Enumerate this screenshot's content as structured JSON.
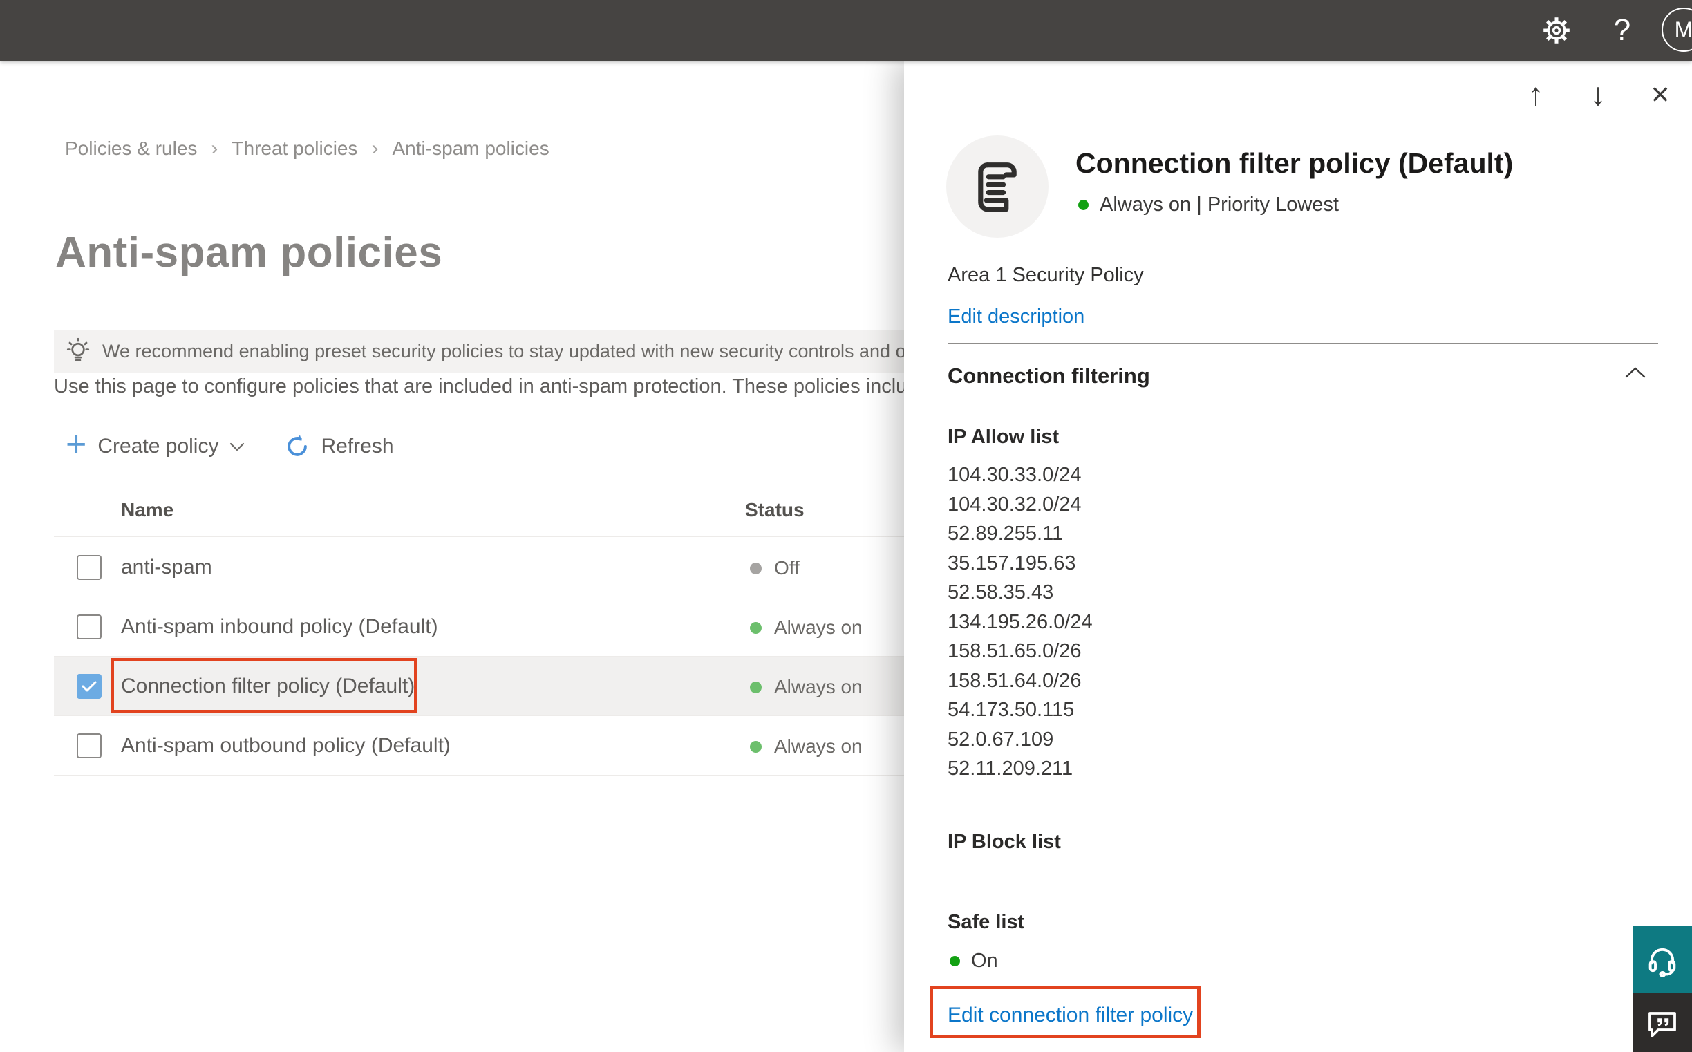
{
  "topbar": {
    "avatar_initial": "M",
    "icons": {
      "settings": "gear-icon",
      "help": "?"
    }
  },
  "breadcrumb": {
    "items": [
      {
        "label": "Policies & rules"
      },
      {
        "label": "Threat policies"
      },
      {
        "label": "Anti-spam policies"
      }
    ],
    "separator": "›"
  },
  "page": {
    "title": "Anti-spam policies",
    "banner_text": "We recommend enabling preset security policies to stay updated with new security controls and our recomme",
    "description": "Use this page to configure policies that are included in anti-spam protection. These policies include"
  },
  "toolbar": {
    "create_label": "Create policy",
    "refresh_label": "Refresh"
  },
  "table": {
    "columns": {
      "name": "Name",
      "status": "Status"
    },
    "rows": [
      {
        "name": "anti-spam",
        "status": "Off",
        "checked": false
      },
      {
        "name": "Anti-spam inbound policy (Default)",
        "status": "Always on",
        "checked": false
      },
      {
        "name": "Connection filter policy (Default)",
        "status": "Always on",
        "checked": true,
        "highlighted": true
      },
      {
        "name": "Anti-spam outbound policy (Default)",
        "status": "Always on",
        "checked": false
      }
    ]
  },
  "flyout": {
    "title": "Connection filter policy (Default)",
    "status_line": "Always on | Priority Lowest",
    "description": "Area 1 Security Policy",
    "edit_description_label": "Edit description",
    "section_label": "Connection filtering",
    "ip_allow": {
      "label": "IP Allow list",
      "ips": [
        "104.30.33.0/24",
        "104.30.32.0/24",
        "52.89.255.11",
        "35.157.195.63",
        "52.58.35.43",
        "134.195.26.0/24",
        "158.51.65.0/26",
        "158.51.64.0/26",
        "54.173.50.115",
        "52.0.67.109",
        "52.11.209.211"
      ]
    },
    "ip_block": {
      "label": "IP Block list"
    },
    "safe_list": {
      "label": "Safe list",
      "status": "On"
    },
    "edit_link_label": "Edit connection filter policy"
  },
  "colors": {
    "accent_blue": "#0b76c9",
    "annotation_red": "#e2431f",
    "status_green": "#6cbf6c",
    "status_green_bright": "#12a112",
    "status_gray": "#a6a4a2",
    "checkbox_blue": "#6cabe3",
    "topbar_bg": "#464442",
    "support_teal": "#0e7a82",
    "feedback_dark": "#2e2c2b"
  }
}
